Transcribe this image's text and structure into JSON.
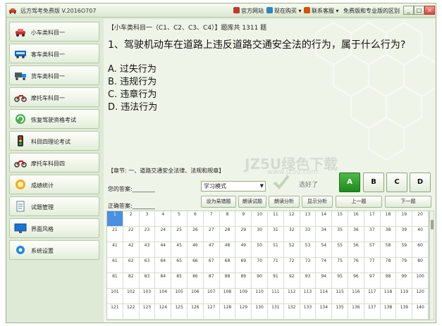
{
  "window": {
    "title": "远方驾考免费版 V.2016O707",
    "links": {
      "official_site": "官方网站",
      "buy_now": "现在购买",
      "contact": "联系客服",
      "diff": "免费版和专业版的区别"
    },
    "controls": {
      "minimize": "_",
      "maximize": "□",
      "close": "×"
    }
  },
  "sidebar": {
    "items": [
      {
        "label": "小车类科目一",
        "icon": "car-icon"
      },
      {
        "label": "客车类科目一",
        "icon": "bus-icon"
      },
      {
        "label": "货车类科目一",
        "icon": "truck-icon"
      },
      {
        "label": "摩托车科目一",
        "icon": "motorcycle-icon"
      },
      {
        "label": "恢复驾驶资格考试",
        "icon": "refresh-icon"
      },
      {
        "label": "科目四理论考试",
        "icon": "traffic-light-icon"
      },
      {
        "label": "摩托车科目四",
        "icon": "motorcycle-icon"
      },
      {
        "label": "成绩统计",
        "icon": "score-medal-icon"
      },
      {
        "label": "试题管理",
        "icon": "document-icon"
      },
      {
        "label": "界面风格",
        "icon": "monitor-icon"
      },
      {
        "label": "系统设置",
        "icon": "gear-icon"
      }
    ]
  },
  "question": {
    "header": "【小车类科目一（C1、C2、C3、C4）】题库共 1311 题",
    "text": "1、驾驶机动车在道路上违反道路交通安全法的行为，属于什么行为?",
    "options": [
      "A. 过失行为",
      "B. 违规行为",
      "C. 违章行为",
      "D. 违法行为"
    ]
  },
  "watermark": {
    "main": "JZ5U绿色下载",
    "sub": "www.jz5u.com"
  },
  "answer_panel": {
    "chapter": "【章节: 一、道路交通安全法律、法规和规章】",
    "your_answer_label": "您的答案:________",
    "correct_answer_label": "正确答案:________",
    "mode_value": "学习模式",
    "mode_arrow": "▼",
    "correct_text": "选好了",
    "option_buttons": [
      "A",
      "B",
      "C",
      "D"
    ],
    "tools": {
      "set_hard": "设为易错题",
      "read_question": "朗读试题",
      "read_analysis": "朗读分析",
      "show_analysis": "显示分析",
      "prev": "上一题",
      "next": "下一题"
    }
  },
  "grid": {
    "active_index": 0,
    "numbers": [
      1,
      2,
      3,
      4,
      5,
      6,
      7,
      8,
      9,
      10,
      11,
      12,
      13,
      14,
      15,
      16,
      17,
      18,
      19,
      20,
      21,
      22,
      23,
      24,
      25,
      26,
      27,
      28,
      29,
      30,
      31,
      32,
      33,
      34,
      35,
      36,
      37,
      38,
      39,
      40,
      41,
      42,
      43,
      44,
      45,
      46,
      47,
      48,
      49,
      50,
      51,
      52,
      53,
      54,
      55,
      56,
      57,
      58,
      59,
      60,
      61,
      62,
      63,
      64,
      65,
      66,
      67,
      68,
      69,
      70,
      71,
      72,
      73,
      74,
      75,
      76,
      77,
      78,
      79,
      80,
      81,
      82,
      83,
      84,
      85,
      86,
      87,
      88,
      89,
      90,
      91,
      92,
      93,
      94,
      95,
      96,
      97,
      98,
      99,
      100,
      101,
      102,
      103,
      104,
      105,
      106,
      107,
      108,
      109,
      110,
      111,
      112,
      113,
      114,
      115,
      116,
      117,
      118,
      119,
      120,
      121,
      122,
      123,
      124,
      125,
      126,
      127,
      128,
      129,
      130,
      131,
      132,
      133,
      134,
      135,
      136,
      137,
      138,
      139,
      140
    ]
  },
  "colors": {
    "accent_green": "#1f8a1d",
    "active_cell": "#4a8fe0",
    "panel_bg": "#eef5e8"
  }
}
